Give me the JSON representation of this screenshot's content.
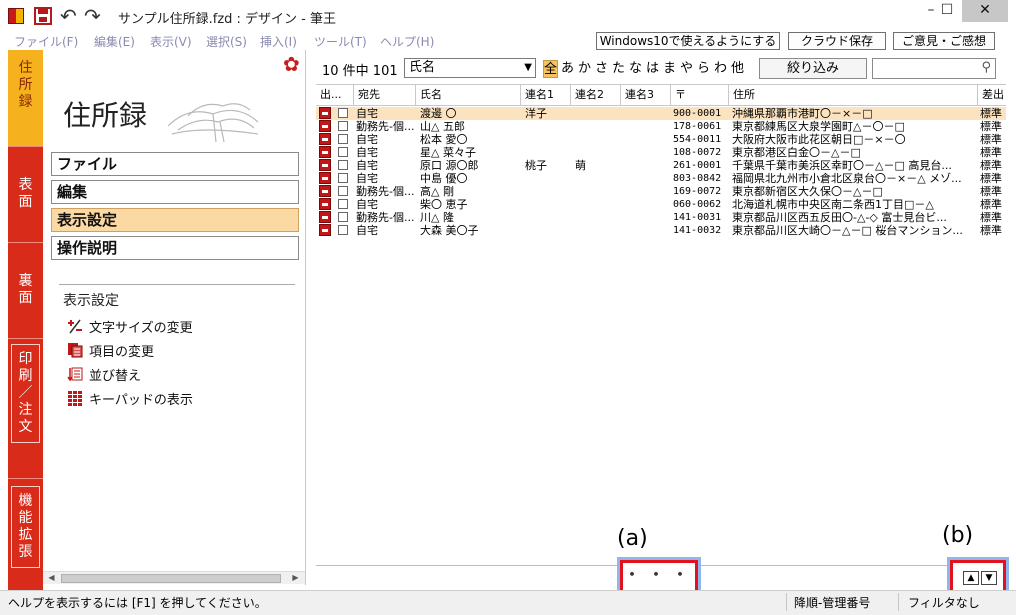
{
  "window": {
    "title": "サンプル住所録.fzd : デザイン - 筆王",
    "minimize": "–",
    "maximize": "☐",
    "close": "✕"
  },
  "menu": [
    "ファイル(F)",
    "編集(E)",
    "表示(V)",
    "選択(S)",
    "挿入(I)",
    "ツール(T)",
    "ヘルプ(H)"
  ],
  "top_buttons": {
    "windows10": "Windows10で使えるようにする",
    "cloud": "クラウド保存",
    "feedback": "ご意見・ご感想"
  },
  "vtabs": [
    {
      "label": [
        "住",
        "所",
        "録"
      ]
    },
    {
      "label": [
        "表",
        "面"
      ]
    },
    {
      "label": [
        "裏",
        "面"
      ]
    },
    {
      "label": [
        "印",
        "刷",
        "／",
        "注",
        "文"
      ]
    },
    {
      "label": [
        "機",
        "能",
        "拡",
        "張"
      ]
    }
  ],
  "left": {
    "logo": "住所録",
    "nav": [
      "ファイル",
      "編集",
      "表示設定",
      "操作説明"
    ],
    "selected_nav": "表示設定",
    "section_title": "表示設定",
    "actions": [
      "文字サイズの変更",
      "項目の変更",
      "並び替え",
      "キーパッドの表示"
    ]
  },
  "toolbar": {
    "count": "10 件中 101",
    "sort_field": "氏名",
    "kana": [
      "全",
      "あ",
      "か",
      "さ",
      "た",
      "な",
      "は",
      "ま",
      "や",
      "ら",
      "わ",
      "他"
    ],
    "kana_active": "全",
    "filter": "絞り込み",
    "search_placeholder": ""
  },
  "table": {
    "headers": [
      "出...",
      "宛先",
      "氏名",
      "連名1",
      "連名2",
      "連名3",
      "〒",
      "住所",
      "差出"
    ],
    "rows": [
      {
        "dest": "自宅",
        "name": "渡邊 〇",
        "ren1": "洋子",
        "ren2": "",
        "zip": "900-0001",
        "addr": "沖縄県那覇市港町〇－×－□",
        "sender": "標準",
        "selected": true
      },
      {
        "dest": "勤務先-個...",
        "name": "山△ 五郎",
        "ren1": "",
        "ren2": "",
        "zip": "178-0061",
        "addr": "東京都練馬区大泉学園町△－〇－□",
        "sender": "標準"
      },
      {
        "dest": "自宅",
        "name": "松本 愛〇",
        "ren1": "",
        "ren2": "",
        "zip": "554-0011",
        "addr": "大阪府大阪市此花区朝日□－×－〇",
        "sender": "標準"
      },
      {
        "dest": "自宅",
        "name": "星△ 菜々子",
        "ren1": "",
        "ren2": "",
        "zip": "108-0072",
        "addr": "東京都港区白金〇－△－□",
        "sender": "標準"
      },
      {
        "dest": "自宅",
        "name": "原口 源〇郎",
        "ren1": "桃子",
        "ren2": "萌",
        "zip": "261-0001",
        "addr": "千葉県千葉市美浜区幸町〇－△－□ 高見台...",
        "sender": "標準"
      },
      {
        "dest": "自宅",
        "name": "中島 優〇",
        "ren1": "",
        "ren2": "",
        "zip": "803-0842",
        "addr": "福岡県北九州市小倉北区泉台〇－×－△ メゾ...",
        "sender": "標準"
      },
      {
        "dest": "勤務先-個...",
        "name": "高△ 剛",
        "ren1": "",
        "ren2": "",
        "zip": "169-0072",
        "addr": "東京都新宿区大久保〇－△－□",
        "sender": "標準"
      },
      {
        "dest": "自宅",
        "name": "柴〇 恵子",
        "ren1": "",
        "ren2": "",
        "zip": "060-0062",
        "addr": "北海道札幌市中央区南二条西1丁目□－△",
        "sender": "標準"
      },
      {
        "dest": "勤務先-個...",
        "name": "川△ 隆",
        "ren1": "",
        "ren2": "",
        "zip": "141-0031",
        "addr": "東京都品川区西五反田〇-△-◇ 富士見台ビ...",
        "sender": "標準"
      },
      {
        "dest": "自宅",
        "name": "大森 美〇子",
        "ren1": "",
        "ren2": "",
        "zip": "141-0032",
        "addr": "東京都品川区大崎〇－△－□ 桜台マンション...",
        "sender": "標準"
      }
    ]
  },
  "bottom": {
    "more_label": "・・・",
    "annot_a": "(a)",
    "annot_b": "(b)",
    "up": "▲",
    "down": "▼"
  },
  "status": {
    "help": "ヘルプを表示するには [F1] を押してください。",
    "sort": "降順-管理番号",
    "filter": "フィルタなし"
  },
  "colors": {
    "brand_red": "#d92b1a",
    "accent_orange": "#f6b11f",
    "highlight": "#e0121c"
  }
}
